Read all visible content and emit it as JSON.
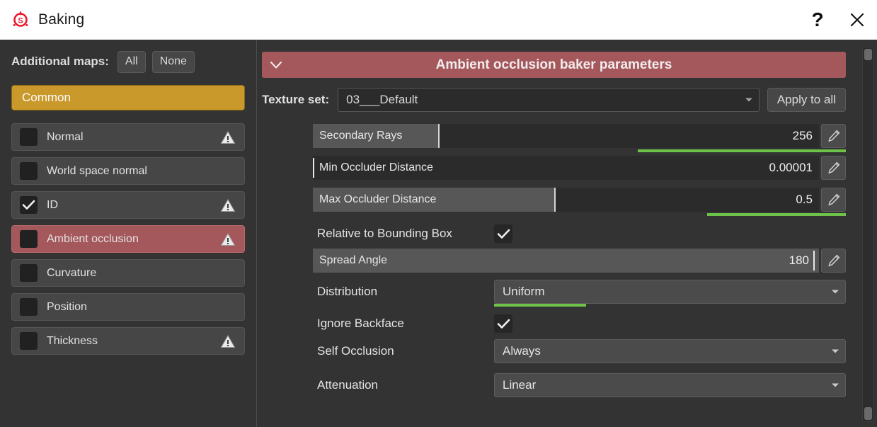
{
  "window": {
    "title": "Baking",
    "logo_icon": "substance-painter-logo",
    "help_label": "?",
    "close_icon": "close-x-icon"
  },
  "left_panel": {
    "additional_maps_label": "Additional maps:",
    "buttons": [
      {
        "label": "All",
        "name": "all-button"
      },
      {
        "label": "None",
        "name": "none-button"
      }
    ],
    "common_tab": {
      "label": "Common",
      "color": "#c9992c"
    },
    "maps": [
      {
        "label": "Normal",
        "checked": false,
        "selected": false,
        "warning": true
      },
      {
        "label": "World space normal",
        "checked": false,
        "selected": false,
        "warning": false
      },
      {
        "label": "ID",
        "checked": true,
        "selected": false,
        "warning": true
      },
      {
        "label": "Ambient occlusion",
        "checked": false,
        "selected": true,
        "warning": true
      },
      {
        "label": "Curvature",
        "checked": false,
        "selected": false,
        "warning": false
      },
      {
        "label": "Position",
        "checked": false,
        "selected": false,
        "warning": false
      },
      {
        "label": "Thickness",
        "checked": false,
        "selected": false,
        "warning": true
      }
    ],
    "selected_color": "#a5585c"
  },
  "right_panel": {
    "section": {
      "title": "Ambient occlusion baker parameters",
      "collapse_icon": "chevron-down-icon",
      "color": "#a5585c"
    },
    "texture_set": {
      "label": "Texture set:",
      "value": "03___Default",
      "caret_icon": "chevron-down-icon",
      "apply_button": "Apply to all"
    },
    "sliders": [
      {
        "name": "Secondary Rays",
        "value": "256",
        "fill_percent": 25,
        "modified": true,
        "modified_from_percent": 65,
        "edit_icon": "pencil-icon"
      },
      {
        "name": "Min Occluder Distance",
        "value": "0.00001",
        "fill_percent": 0,
        "modified": false,
        "edit_icon": "pencil-icon"
      },
      {
        "name": "Max Occluder Distance",
        "value": "0.5",
        "fill_percent": 48,
        "modified": true,
        "modified_from_percent": 72,
        "edit_icon": "pencil-icon"
      }
    ],
    "relative_bbox": {
      "label": "Relative to Bounding Box",
      "checked": true,
      "check_icon": "checkmark-icon"
    },
    "spread_angle": {
      "name": "Spread Angle",
      "value": "180",
      "fill_percent": 100,
      "modified": false,
      "edit_icon": "pencil-icon"
    },
    "distribution": {
      "label": "Distribution",
      "value": "Uniform",
      "caret_icon": "chevron-down-icon",
      "modified": true,
      "modified_color": "#6ec24a"
    },
    "ignore_backface": {
      "label": "Ignore Backface",
      "checked": true,
      "check_icon": "checkmark-icon"
    },
    "self_occlusion": {
      "label": "Self Occlusion",
      "value": "Always",
      "caret_icon": "chevron-down-icon"
    },
    "attenuation": {
      "label": "Attenuation",
      "value": "Linear",
      "caret_icon": "chevron-down-icon"
    },
    "scrollbar": {
      "name": "vertical-scrollbar"
    }
  }
}
